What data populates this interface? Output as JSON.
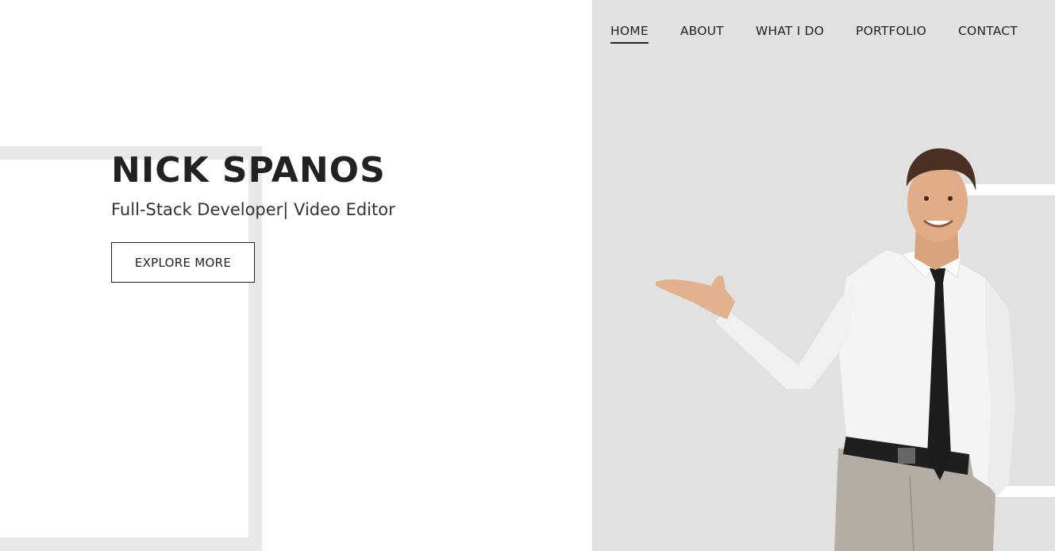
{
  "nav": {
    "items": [
      {
        "label": "HOME",
        "active": true
      },
      {
        "label": "ABOUT",
        "active": false
      },
      {
        "label": "WHAT I DO",
        "active": false
      },
      {
        "label": "PORTFOLIO",
        "active": false
      },
      {
        "label": "CONTACT",
        "active": false
      }
    ]
  },
  "hero": {
    "name": "NICK SPANOS",
    "subtitle": "Full-Stack Developer| Video Editor",
    "button_label": "EXPLORE MORE"
  },
  "colors": {
    "text": "#222222",
    "left_bg": "#ffffff",
    "right_bg": "#e1e1e1",
    "frame_light": "#e8e8e8"
  },
  "image": {
    "subject": "smiling-businessman-presenting-hand-icon"
  }
}
